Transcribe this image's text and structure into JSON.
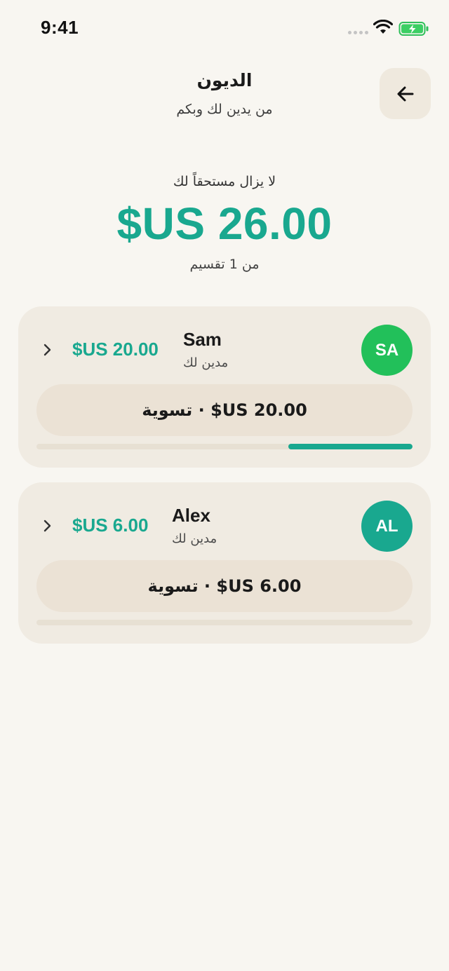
{
  "status_bar": {
    "time": "9:41"
  },
  "header": {
    "title": "الديون",
    "subtitle": "من يدين لك وبكم",
    "back_icon": "arrow-left-icon"
  },
  "summary": {
    "label": "لا يزال  مستحقاً لك",
    "amount": "$US 26.00",
    "from": "من 1 تقسيم"
  },
  "debts": [
    {
      "initials": "SA",
      "name": "Sam",
      "status": "مدين لك",
      "amount": "$US 20.00",
      "settle_label": "تسوية · $US 20.00",
      "avatar_color": "#22c05a",
      "progress": 0.33
    },
    {
      "initials": "AL",
      "name": "Alex",
      "status": "مدين لك",
      "amount": "$US 6.00",
      "settle_label": "تسوية · $US 6.00",
      "avatar_color": "#19a88f",
      "progress": 0
    }
  ],
  "colors": {
    "accent": "#19a88f",
    "background": "#f8f6f1",
    "card": "#f0ebe2"
  }
}
